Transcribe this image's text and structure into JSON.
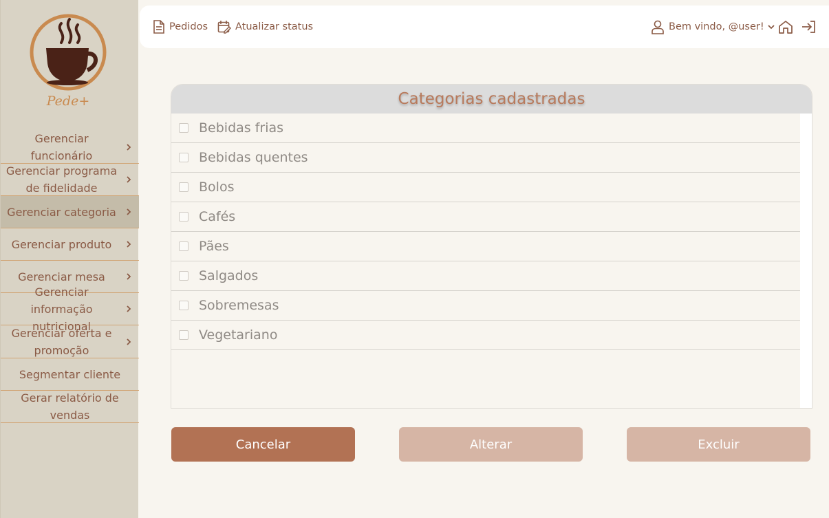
{
  "logo": {
    "text": "Pede+"
  },
  "sidebar": {
    "items": [
      {
        "label": "Gerenciar funcionário",
        "chevron": true,
        "active": false
      },
      {
        "label": "Gerenciar programa de fidelidade",
        "chevron": true,
        "active": false
      },
      {
        "label": "Gerenciar categoria",
        "chevron": true,
        "active": true
      },
      {
        "label": "Gerenciar produto",
        "chevron": true,
        "active": false
      },
      {
        "label": "Gerenciar mesa",
        "chevron": true,
        "active": false
      },
      {
        "label": "Gerenciar informação nutricional",
        "chevron": true,
        "active": false
      },
      {
        "label": "Gerenciar oferta e promoção",
        "chevron": true,
        "active": false
      },
      {
        "label": "Segmentar cliente",
        "chevron": false,
        "active": false
      },
      {
        "label": "Gerar relatório de vendas",
        "chevron": false,
        "active": false
      }
    ]
  },
  "topbar": {
    "orders": "Pedidos",
    "update_status": "Atualizar status",
    "welcome": "Bem vindo, @user!"
  },
  "panel": {
    "title": "Categorias cadastradas",
    "categories": [
      "Bebidas frias",
      "Bebidas quentes",
      "Bolos",
      "Cafés",
      "Pães",
      "Salgados",
      "Sobremesas",
      "Vegetariano"
    ]
  },
  "buttons": {
    "cancel": "Cancelar",
    "alter": "Alterar",
    "delete": "Excluir"
  },
  "colors": {
    "accent": "#b27254",
    "accent_disabled": "#d6b5a5",
    "sidebar_bg": "#d9d3c5",
    "active_item_bg": "#c4bca9",
    "text_brown": "#8a5a45"
  }
}
